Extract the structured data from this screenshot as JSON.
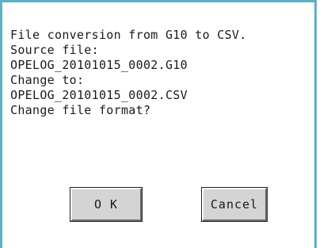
{
  "dialog": {
    "message_lines": [
      "File conversion from G10 to CSV.",
      "Source file:",
      "OPELOG_20101015_0002.G10",
      "Change to:",
      "OPELOG_20101015_0002.CSV",
      "Change file format?"
    ],
    "ok_label": "O K",
    "cancel_label": "Cancel"
  },
  "colors": {
    "border": "#56b4c6",
    "button_face": "#d4d4d4"
  }
}
